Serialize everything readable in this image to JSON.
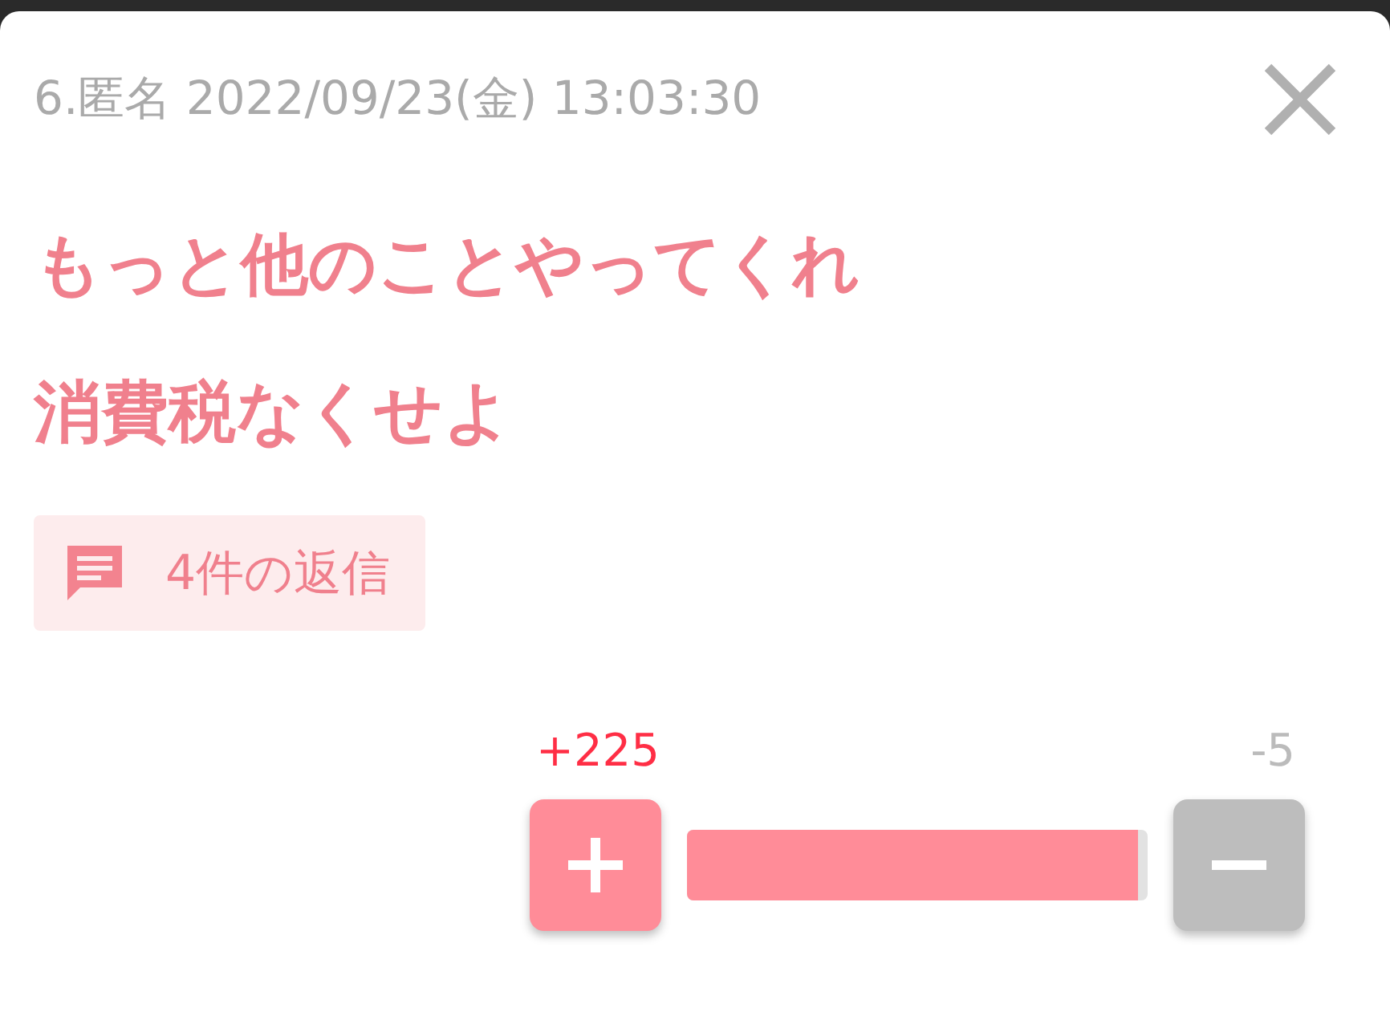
{
  "header": {
    "text": "6.匿名 2022/09/23(金) 13:03:30"
  },
  "comment": {
    "lines": [
      "もっと他のことやってくれ",
      "消費税なくせよ"
    ]
  },
  "replies": {
    "label": "4件の返信"
  },
  "votes": {
    "plus": "+225",
    "minus": "-5",
    "level": 0.978
  }
}
